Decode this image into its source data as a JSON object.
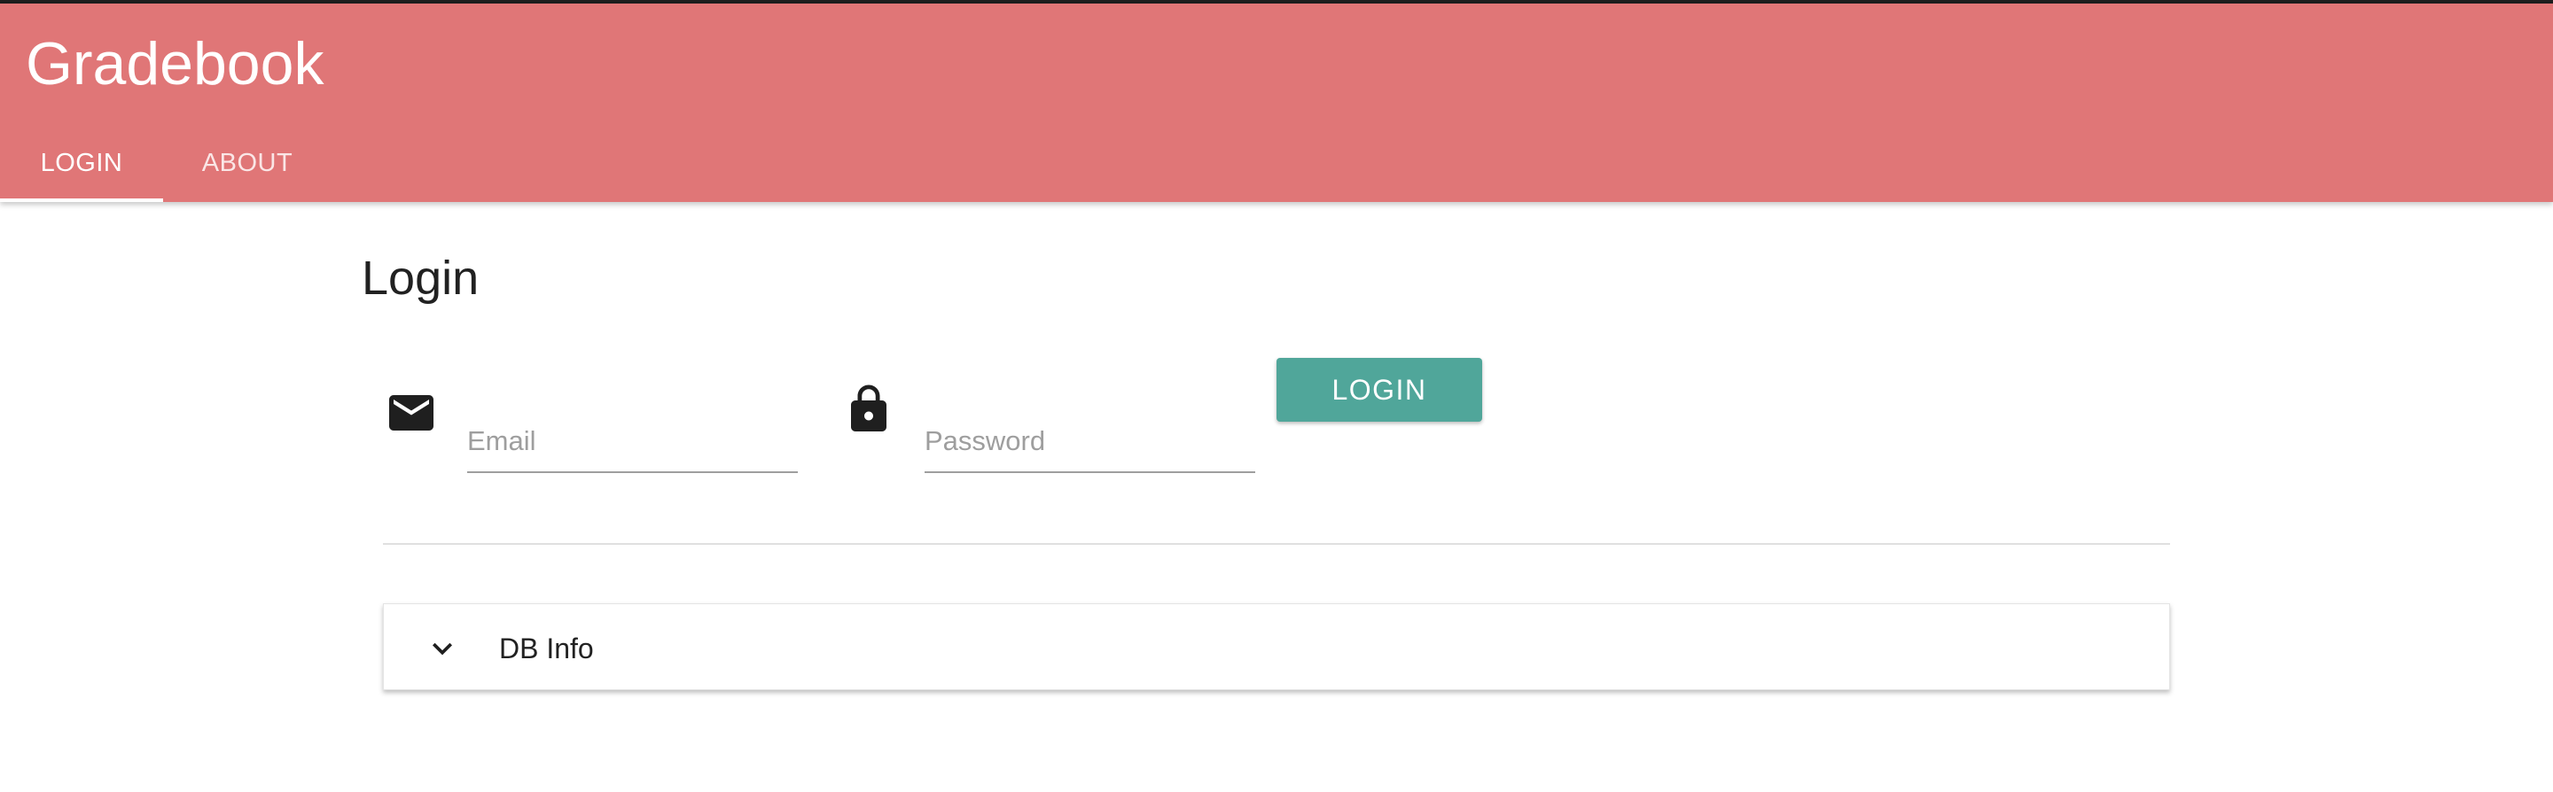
{
  "app": {
    "title": "Gradebook",
    "accent_color": "#e07677"
  },
  "tabs": [
    {
      "label": "LOGIN",
      "active": true
    },
    {
      "label": "ABOUT",
      "active": false
    }
  ],
  "login": {
    "heading": "Login",
    "email": {
      "icon": "mail-icon",
      "placeholder": "Email",
      "value": ""
    },
    "password": {
      "icon": "lock-icon",
      "placeholder": "Password",
      "value": ""
    },
    "submit_label": "LOGIN",
    "submit_color": "#50a69a"
  },
  "db_info": {
    "icon": "chevron-down-icon",
    "label": "DB Info",
    "expanded": false
  }
}
